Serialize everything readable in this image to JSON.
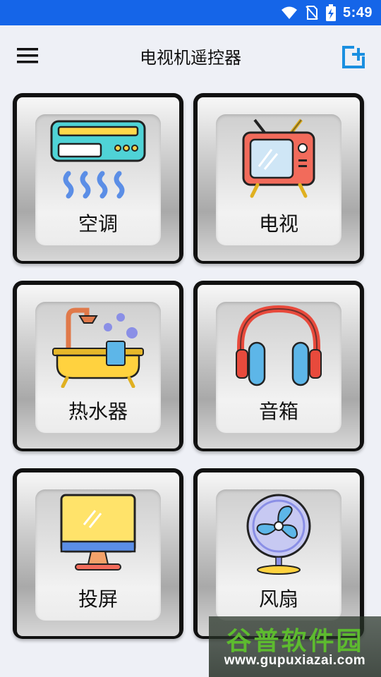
{
  "status_bar": {
    "time": "5:49",
    "icons": [
      "wifi-icon",
      "no-sim-icon",
      "battery-charging-icon"
    ],
    "background": "#1565e8"
  },
  "app_bar": {
    "title": "电视机遥控器",
    "menu_icon": "hamburger-menu-icon",
    "add_icon": "add-remote-icon",
    "accent": "#1a8fe0"
  },
  "devices": [
    {
      "label": "空调",
      "icon": "air-conditioner-icon"
    },
    {
      "label": "电视",
      "icon": "tv-icon"
    },
    {
      "label": "热水器",
      "icon": "water-heater-icon"
    },
    {
      "label": "音箱",
      "icon": "headphones-speaker-icon"
    },
    {
      "label": "投屏",
      "icon": "monitor-cast-icon"
    },
    {
      "label": "风扇",
      "icon": "fan-icon"
    }
  ],
  "watermark": {
    "name": "谷普软件园",
    "url": "www.gupuxiazai.com"
  }
}
